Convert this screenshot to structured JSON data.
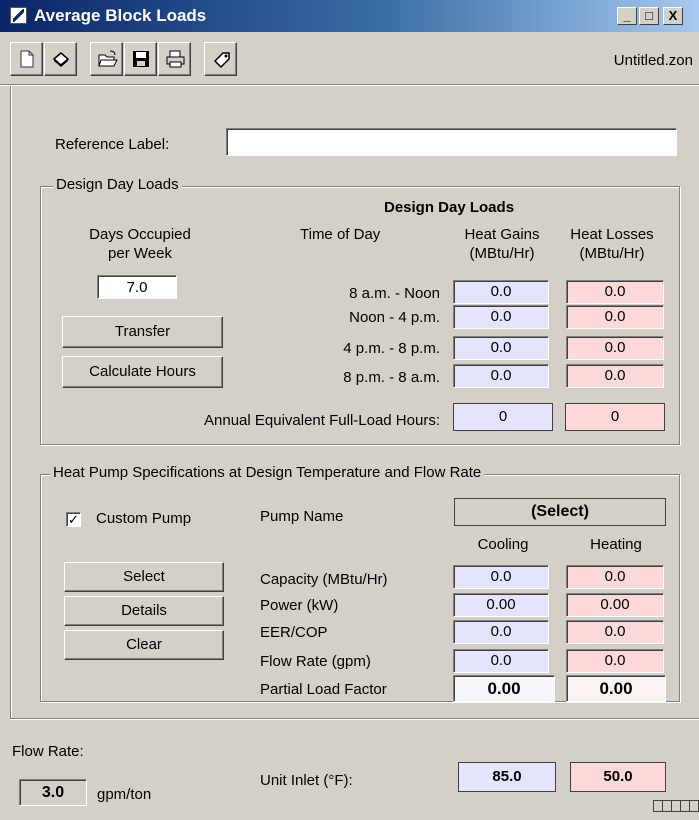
{
  "window": {
    "title": "Average Block Loads",
    "filename": "Untitled.zon"
  },
  "caption_buttons": [
    "_",
    "□",
    "X"
  ],
  "toolbar": {
    "buttons": [
      "new-document-icon",
      "erase-icon",
      "open-folder-icon",
      "save-disk-icon",
      "print-icon",
      "tag-icon"
    ]
  },
  "reference": {
    "label": "Reference Label:",
    "value": ""
  },
  "design_day": {
    "group_label": "Design Day Loads",
    "table_title": "Design Day Loads",
    "days_occupied_label_1": "Days Occupied",
    "days_occupied_label_2": "per Week",
    "days_occupied_value": "7.0",
    "transfer_button": "Transfer",
    "calculate_button": "Calculate Hours",
    "time_of_day_header": "Time of Day",
    "gains_header_1": "Heat Gains",
    "gains_header_2": "(MBtu/Hr)",
    "losses_header_1": "Heat Losses",
    "losses_header_2": "(MBtu/Hr)",
    "rows": [
      {
        "time": "8 a.m. - Noon",
        "gain": "0.0",
        "loss": "0.0"
      },
      {
        "time": "Noon - 4 p.m.",
        "gain": "0.0",
        "loss": "0.0"
      },
      {
        "time": "4 p.m. - 8 p.m.",
        "gain": "0.0",
        "loss": "0.0"
      },
      {
        "time": "8 p.m. - 8 a.m.",
        "gain": "0.0",
        "loss": "0.0"
      }
    ],
    "annual_label": "Annual Equivalent Full-Load Hours:",
    "annual_gain": "0",
    "annual_loss": "0"
  },
  "heat_pump": {
    "group_label": "Heat Pump Specifications at Design Temperature and Flow Rate",
    "custom_pump_label": "Custom Pump",
    "custom_pump_checked": "✓",
    "pump_name_label": "Pump Name",
    "pump_name_value": "(Select)",
    "cooling_header": "Cooling",
    "heating_header": "Heating",
    "select_button": "Select",
    "details_button": "Details",
    "clear_button": "Clear",
    "rows": [
      {
        "label": "Capacity (MBtu/Hr)",
        "cooling": "0.0",
        "heating": "0.0"
      },
      {
        "label": "Power (kW)",
        "cooling": "0.00",
        "heating": "0.00"
      },
      {
        "label": "EER/COP",
        "cooling": "0.0",
        "heating": "0.0"
      },
      {
        "label": "Flow Rate (gpm)",
        "cooling": "0.0",
        "heating": "0.0"
      },
      {
        "label": "Partial Load Factor",
        "cooling": "0.00",
        "heating": "0.00"
      }
    ]
  },
  "bottom": {
    "flow_rate_label": "Flow Rate:",
    "flow_rate_value": "3.0",
    "flow_rate_unit": "gpm/ton",
    "unit_inlet_label": "Unit Inlet (°F):",
    "unit_inlet_cooling": "85.0",
    "unit_inlet_heating": "50.0"
  },
  "colors": {
    "gain_fill": "#e4e4fe",
    "loss_fill": "#fcd8d8",
    "title_bar": "#0a246a"
  }
}
